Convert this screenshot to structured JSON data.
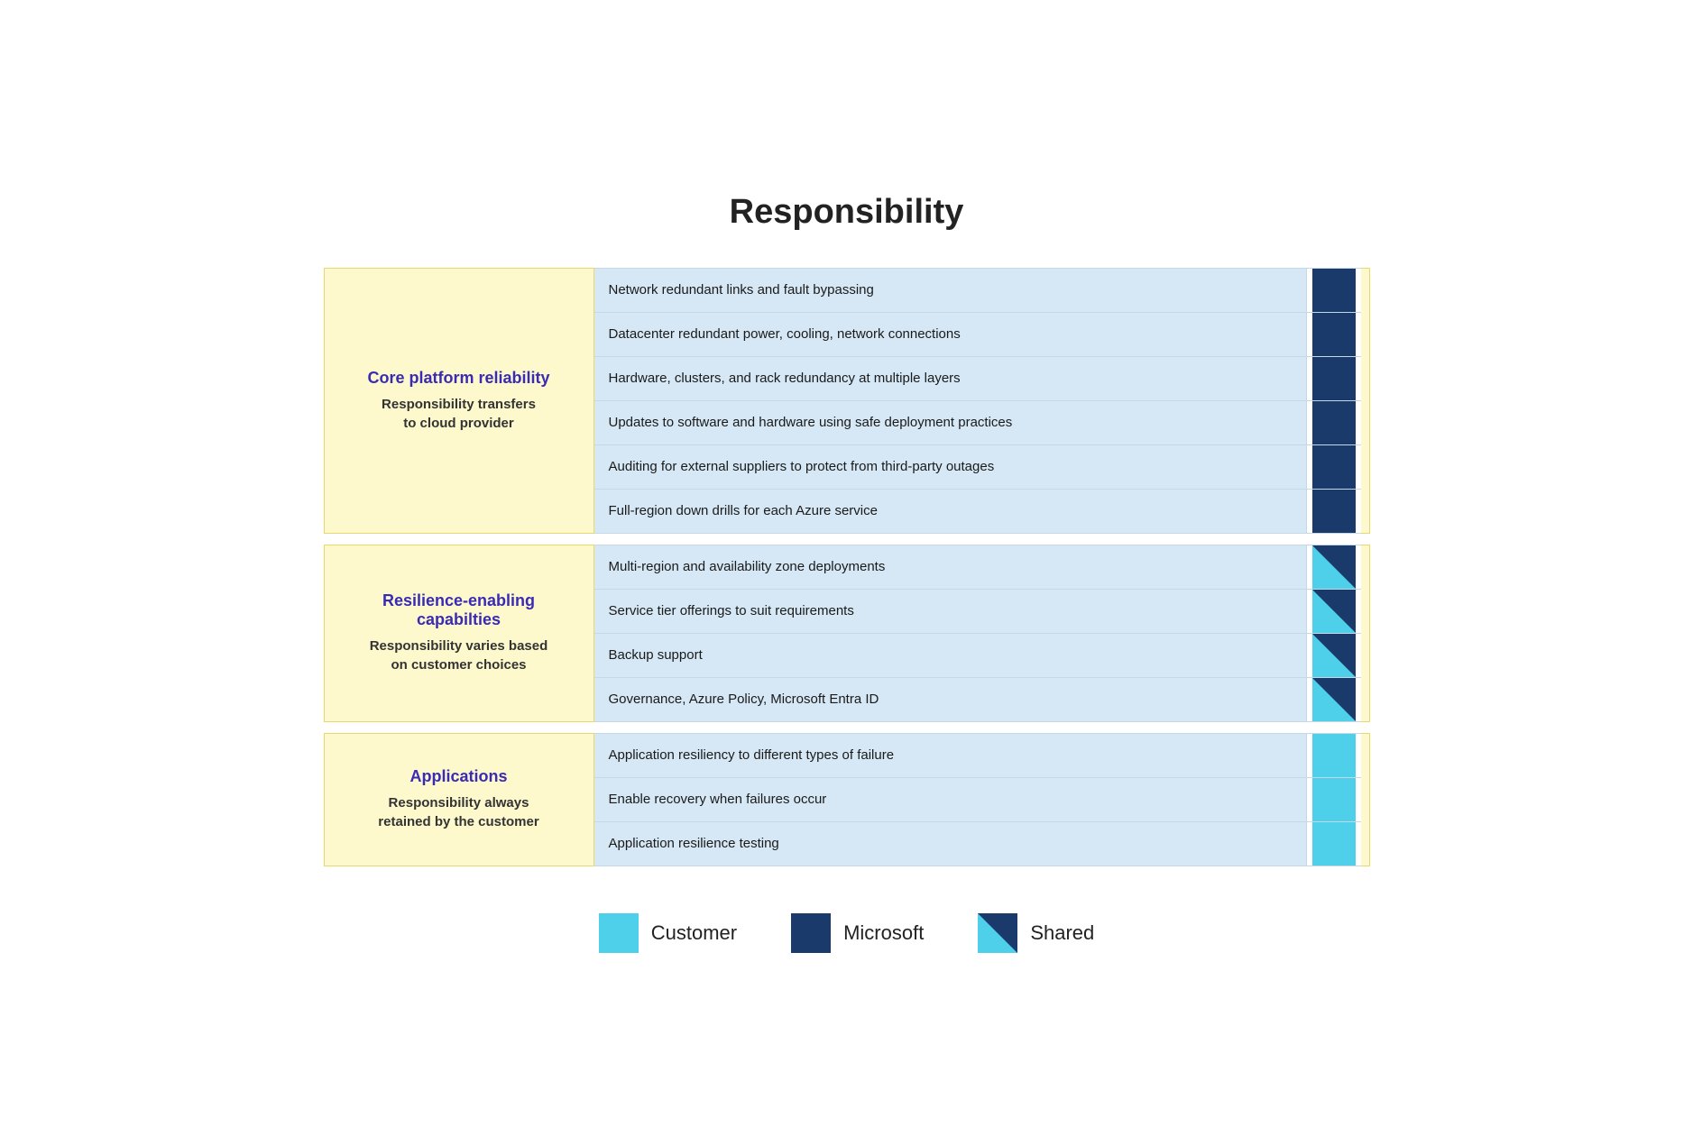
{
  "title": "Responsibility",
  "sections": [
    {
      "id": "core-platform",
      "title": "Core platform reliability",
      "subtitle": "Responsibility transfers\nto cloud provider",
      "items": [
        {
          "text": "Network redundant links and fault bypassing",
          "indicator": "microsoft"
        },
        {
          "text": "Datacenter redundant power, cooling, network connections",
          "indicator": "microsoft"
        },
        {
          "text": "Hardware, clusters, and rack redundancy at multiple layers",
          "indicator": "microsoft"
        },
        {
          "text": "Updates to software and hardware using safe deployment practices",
          "indicator": "microsoft"
        },
        {
          "text": "Auditing for external suppliers to protect from third-party outages",
          "indicator": "microsoft"
        },
        {
          "text": "Full-region down drills for each Azure service",
          "indicator": "microsoft"
        }
      ]
    },
    {
      "id": "resilience-enabling",
      "title": "Resilience-enabling capabilties",
      "subtitle": "Responsibility varies based\non customer choices",
      "items": [
        {
          "text": "Multi-region and availability zone deployments",
          "indicator": "shared"
        },
        {
          "text": "Service tier offerings to suit requirements",
          "indicator": "shared"
        },
        {
          "text": "Backup support",
          "indicator": "shared"
        },
        {
          "text": "Governance, Azure Policy, Microsoft Entra ID",
          "indicator": "shared"
        }
      ]
    },
    {
      "id": "applications",
      "title": "Applications",
      "subtitle": "Responsibility always\nretained by the customer",
      "items": [
        {
          "text": "Application resiliency to different types of failure",
          "indicator": "customer"
        },
        {
          "text": "Enable recovery when failures occur",
          "indicator": "customer"
        },
        {
          "text": "Application resilience testing",
          "indicator": "customer"
        }
      ]
    }
  ],
  "legend": [
    {
      "id": "customer",
      "label": "Customer",
      "type": "customer"
    },
    {
      "id": "microsoft",
      "label": "Microsoft",
      "type": "microsoft"
    },
    {
      "id": "shared",
      "label": "Shared",
      "type": "shared"
    }
  ]
}
